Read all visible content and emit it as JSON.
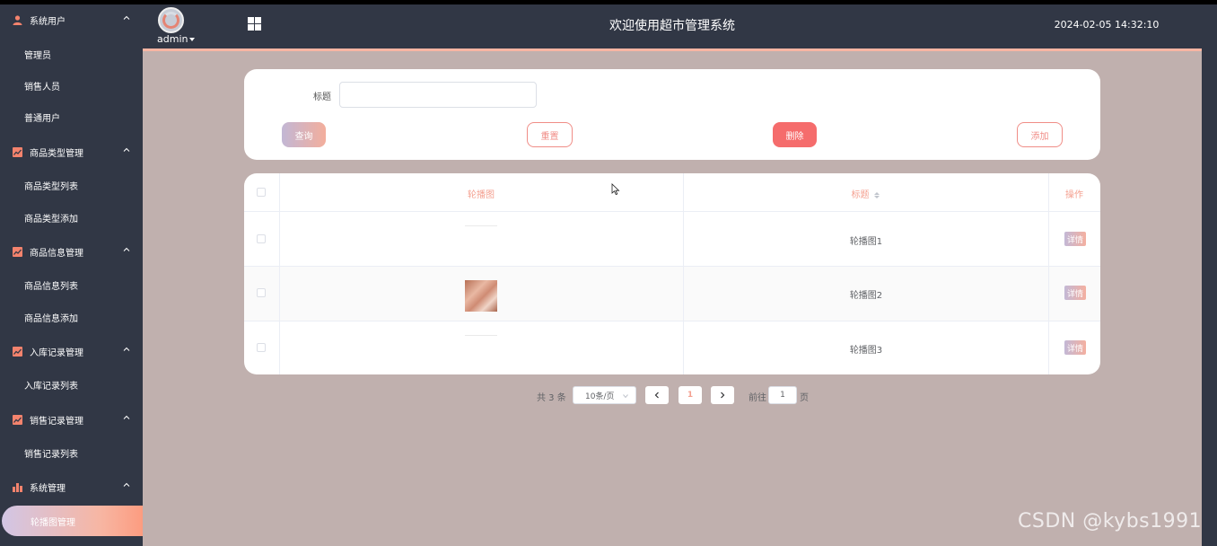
{
  "header": {
    "user": "admin",
    "title": "欢迎使用超市管理系统",
    "datetime": "2024-02-05 14:32:10"
  },
  "sidebar": {
    "groups": [
      {
        "label": "系统用户",
        "icon": "user-icon",
        "items": [
          "管理员",
          "销售人员",
          "普通用户"
        ]
      },
      {
        "label": "商品类型管理",
        "icon": "chart-icon",
        "items": [
          "商品类型列表",
          "商品类型添加"
        ]
      },
      {
        "label": "商品信息管理",
        "icon": "chart-icon",
        "items": [
          "商品信息列表",
          "商品信息添加"
        ]
      },
      {
        "label": "入库记录管理",
        "icon": "chart-icon",
        "items": [
          "入库记录列表"
        ]
      },
      {
        "label": "销售记录管理",
        "icon": "chart-icon",
        "items": [
          "销售记录列表"
        ]
      },
      {
        "label": "系统管理",
        "icon": "bar-chart-icon",
        "items": [
          "轮播图管理"
        ]
      }
    ],
    "active_item": "轮播图管理"
  },
  "search": {
    "title_label": "标题",
    "title_value": "",
    "query_label": "查询",
    "reset_label": "重置",
    "delete_label": "删除",
    "add_label": "添加"
  },
  "table": {
    "columns": [
      "轮播图",
      "标题",
      "操作"
    ],
    "rows": [
      {
        "title": "轮播图1",
        "action": "详情"
      },
      {
        "title": "轮播图2",
        "action": "详情"
      },
      {
        "title": "轮播图3",
        "action": "详情"
      }
    ]
  },
  "pagination": {
    "total": "共 3 条",
    "page_size": "10条/页",
    "current_page": "1",
    "goto_label": "前往",
    "goto_value": "1",
    "page_suffix": "页"
  },
  "watermark": "CSDN @kybs1991",
  "colors": {
    "sidebar": "#313745",
    "background": "#c0b0ae",
    "accent": "#f8b5a3",
    "delete": "#f56c6c",
    "header_text": "#f4a090"
  }
}
